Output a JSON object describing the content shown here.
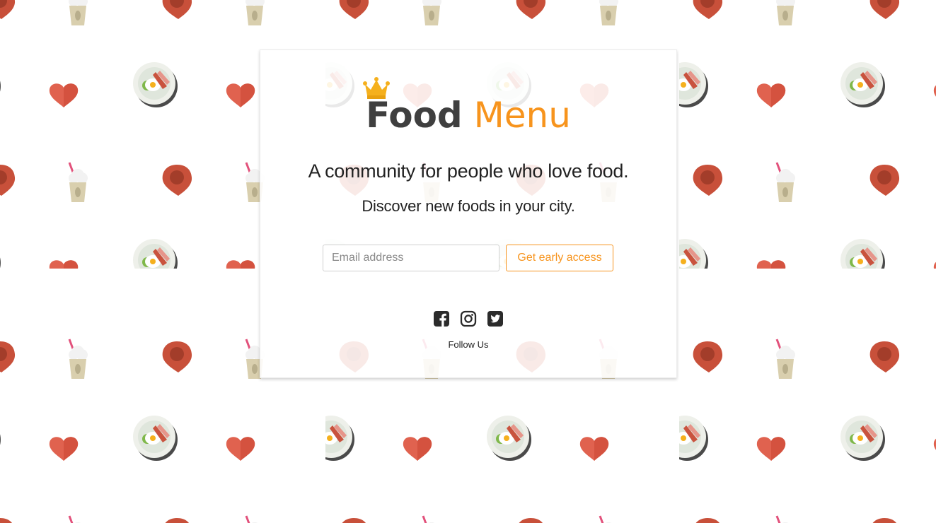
{
  "brand": {
    "name_part1": "Food",
    "name_part2": "Menu",
    "primary_color": "#3f3f3f",
    "accent_color": "#f7941d",
    "crown_icon": "crown-icon"
  },
  "hero": {
    "tagline": "A community for people who love food.",
    "subtagline": "Discover new foods in your city."
  },
  "signup": {
    "email_placeholder": "Email address",
    "email_value": "",
    "button_label": "Get early access"
  },
  "social": {
    "icons": [
      "facebook-icon",
      "instagram-icon",
      "twitter-icon"
    ],
    "follow_label": "Follow Us"
  },
  "background": {
    "pattern_icons": [
      "heart-icon",
      "breakfast-plate-icon",
      "milkshake-icon",
      "location-pin-icon"
    ],
    "heart_color": "#e0624f",
    "pin_color": "#c8503a",
    "cup_color": "#d9cfae",
    "straw_color": "#e2517b"
  }
}
